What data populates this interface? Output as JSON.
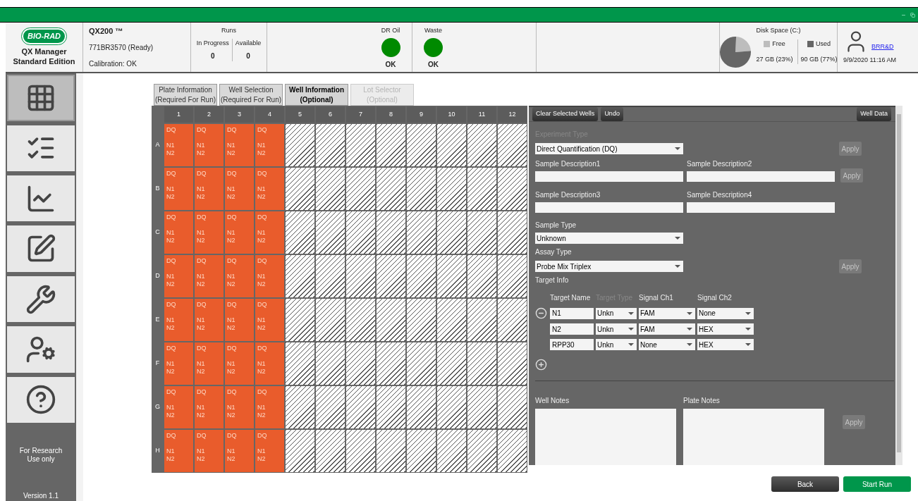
{
  "header": {
    "logo": "BIO-RAD",
    "product": "QX Manager Standard Edition",
    "instrument": {
      "model": "QX200 ™",
      "serial": "771BR3570 (Ready)",
      "calibration": "Calibration: OK"
    },
    "runs": {
      "title": "Runs",
      "columns": [
        {
          "label": "In Progress",
          "value": "0"
        },
        {
          "label": "Available",
          "value": "0"
        }
      ]
    },
    "indicators": [
      {
        "label": "DR Oil",
        "status": "OK",
        "color": "#008a00"
      },
      {
        "label": "Waste",
        "status": "OK",
        "color": "#008a00"
      }
    ],
    "disk": {
      "title": "Disk Space (C:)",
      "chart_data": {
        "type": "pie",
        "categories": [
          "Free",
          "Used"
        ],
        "values": [
          23,
          77
        ]
      },
      "readings": [
        "27 GB (23%)",
        "90 GB (77%)"
      ]
    },
    "user": {
      "name": "BRR&D",
      "datetime": "9/9/2020 11:16 AM"
    }
  },
  "sidebar": {
    "items": [
      {
        "kind": "plate-run",
        "selected": true
      },
      {
        "kind": "checklist",
        "selected": false
      },
      {
        "kind": "chart",
        "selected": false
      },
      {
        "kind": "layout-edit",
        "selected": false
      },
      {
        "kind": "tools",
        "selected": false
      },
      {
        "kind": "users",
        "selected": false
      },
      {
        "kind": "help",
        "selected": false
      }
    ],
    "note": "For Research Use only",
    "version": "Version 1.1"
  },
  "tabs": [
    {
      "title": "Plate Information",
      "subtitle": "(Required For Run)",
      "selected": false,
      "disabled": false
    },
    {
      "title": "Well Selection",
      "subtitle": "(Required For Run)",
      "selected": false,
      "disabled": false
    },
    {
      "title": "Well Information",
      "subtitle": "(Optional)",
      "selected": true,
      "disabled": false
    },
    {
      "title": "Lot Selector",
      "subtitle": "(Optional)",
      "selected": false,
      "disabled": true
    }
  ],
  "plate": {
    "columns": [
      "1",
      "2",
      "3",
      "4",
      "5",
      "6",
      "7",
      "8",
      "9",
      "10",
      "11",
      "12"
    ],
    "rows": [
      {
        "label": "A",
        "wells": [
          {
            "kind": "sample",
            "lines": [
              "DQ",
              "N1",
              "N2"
            ]
          },
          {
            "kind": "sample",
            "lines": [
              "DQ",
              "N1",
              "N2"
            ]
          },
          {
            "kind": "sample",
            "lines": [
              "DQ",
              "N1",
              "N2"
            ]
          },
          {
            "kind": "sample",
            "lines": [
              "DQ",
              "N1",
              "N2"
            ]
          },
          {
            "kind": "empty"
          },
          {
            "kind": "empty"
          },
          {
            "kind": "empty"
          },
          {
            "kind": "empty"
          },
          {
            "kind": "empty"
          },
          {
            "kind": "empty"
          },
          {
            "kind": "empty"
          },
          {
            "kind": "empty"
          }
        ]
      },
      {
        "label": "B",
        "wells": [
          {
            "kind": "sample",
            "lines": [
              "DQ",
              "N1",
              "N2"
            ]
          },
          {
            "kind": "sample",
            "lines": [
              "DQ",
              "N1",
              "N2"
            ]
          },
          {
            "kind": "sample",
            "lines": [
              "DQ",
              "N1",
              "N2"
            ]
          },
          {
            "kind": "sample",
            "lines": [
              "DQ",
              "N1",
              "N2"
            ]
          },
          {
            "kind": "empty"
          },
          {
            "kind": "empty"
          },
          {
            "kind": "empty"
          },
          {
            "kind": "empty"
          },
          {
            "kind": "empty"
          },
          {
            "kind": "empty"
          },
          {
            "kind": "empty"
          },
          {
            "kind": "empty"
          }
        ]
      },
      {
        "label": "C",
        "wells": [
          {
            "kind": "sample",
            "lines": [
              "DQ",
              "N1",
              "N2"
            ]
          },
          {
            "kind": "sample",
            "lines": [
              "DQ",
              "N1",
              "N2"
            ]
          },
          {
            "kind": "sample",
            "lines": [
              "DQ",
              "N1",
              "N2"
            ]
          },
          {
            "kind": "sample",
            "lines": [
              "DQ",
              "N1",
              "N2"
            ]
          },
          {
            "kind": "empty"
          },
          {
            "kind": "empty"
          },
          {
            "kind": "empty"
          },
          {
            "kind": "empty"
          },
          {
            "kind": "empty"
          },
          {
            "kind": "empty"
          },
          {
            "kind": "empty"
          },
          {
            "kind": "empty"
          }
        ]
      },
      {
        "label": "D",
        "wells": [
          {
            "kind": "sample",
            "lines": [
              "DQ",
              "N1",
              "N2"
            ]
          },
          {
            "kind": "sample",
            "lines": [
              "DQ",
              "N1",
              "N2"
            ]
          },
          {
            "kind": "sample",
            "lines": [
              "DQ",
              "N1",
              "N2"
            ]
          },
          {
            "kind": "sample",
            "lines": [
              "DQ",
              "N1",
              "N2"
            ]
          },
          {
            "kind": "empty"
          },
          {
            "kind": "empty"
          },
          {
            "kind": "empty"
          },
          {
            "kind": "empty"
          },
          {
            "kind": "empty"
          },
          {
            "kind": "empty"
          },
          {
            "kind": "empty"
          },
          {
            "kind": "empty"
          }
        ]
      },
      {
        "label": "E",
        "wells": [
          {
            "kind": "sample",
            "lines": [
              "DQ",
              "N1",
              "N2"
            ]
          },
          {
            "kind": "sample",
            "lines": [
              "DQ",
              "N1",
              "N2"
            ]
          },
          {
            "kind": "sample",
            "lines": [
              "DQ",
              "N1",
              "N2"
            ]
          },
          {
            "kind": "sample",
            "lines": [
              "DQ",
              "N1",
              "N2"
            ]
          },
          {
            "kind": "empty"
          },
          {
            "kind": "empty"
          },
          {
            "kind": "empty"
          },
          {
            "kind": "empty"
          },
          {
            "kind": "empty"
          },
          {
            "kind": "empty"
          },
          {
            "kind": "empty"
          },
          {
            "kind": "empty"
          }
        ]
      },
      {
        "label": "F",
        "wells": [
          {
            "kind": "sample",
            "lines": [
              "DQ",
              "N1",
              "N2"
            ]
          },
          {
            "kind": "sample",
            "lines": [
              "DQ",
              "N1",
              "N2"
            ]
          },
          {
            "kind": "sample",
            "lines": [
              "DQ",
              "N1",
              "N2"
            ]
          },
          {
            "kind": "sample",
            "lines": [
              "DQ",
              "N1",
              "N2"
            ]
          },
          {
            "kind": "empty"
          },
          {
            "kind": "empty"
          },
          {
            "kind": "empty"
          },
          {
            "kind": "empty"
          },
          {
            "kind": "empty"
          },
          {
            "kind": "empty"
          },
          {
            "kind": "empty"
          },
          {
            "kind": "empty"
          }
        ]
      },
      {
        "label": "G",
        "wells": [
          {
            "kind": "sample",
            "lines": [
              "DQ",
              "N1",
              "N2"
            ]
          },
          {
            "kind": "sample",
            "lines": [
              "DQ",
              "N1",
              "N2"
            ]
          },
          {
            "kind": "sample",
            "lines": [
              "DQ",
              "N1",
              "N2"
            ]
          },
          {
            "kind": "sample",
            "lines": [
              "DQ",
              "N1",
              "N2"
            ]
          },
          {
            "kind": "empty"
          },
          {
            "kind": "empty"
          },
          {
            "kind": "empty"
          },
          {
            "kind": "empty"
          },
          {
            "kind": "empty"
          },
          {
            "kind": "empty"
          },
          {
            "kind": "empty"
          },
          {
            "kind": "empty"
          }
        ]
      },
      {
        "label": "H",
        "wells": [
          {
            "kind": "sample",
            "lines": [
              "DQ",
              "N1",
              "N2"
            ]
          },
          {
            "kind": "sample",
            "lines": [
              "DQ",
              "N1",
              "N2"
            ]
          },
          {
            "kind": "sample",
            "lines": [
              "DQ",
              "N1",
              "N2"
            ]
          },
          {
            "kind": "sample",
            "lines": [
              "DQ",
              "N1",
              "N2"
            ]
          },
          {
            "kind": "empty"
          },
          {
            "kind": "empty"
          },
          {
            "kind": "empty"
          },
          {
            "kind": "empty"
          },
          {
            "kind": "empty"
          },
          {
            "kind": "empty"
          },
          {
            "kind": "empty"
          },
          {
            "kind": "empty"
          }
        ]
      }
    ]
  },
  "well_panel": {
    "toolbar": [
      "Clear Selected Wells",
      "Undo"
    ],
    "well_data": "Well Data",
    "experiment_type": {
      "label": "Experiment Type",
      "label_dimmed": true,
      "value": "Direct Quantification (DQ)"
    },
    "descriptions": [
      {
        "label": "Sample Description1"
      },
      {
        "label": "Sample Description2"
      },
      {
        "label": "Sample Description3"
      },
      {
        "label": "Sample Description4"
      }
    ],
    "sample_type": {
      "label": "Sample Type",
      "value": "Unknown"
    },
    "assay_type": {
      "label": "Assay Type",
      "value": "Probe Mix Triplex"
    },
    "apply_buttons": [
      {
        "label": "Apply",
        "disabled": true
      },
      {
        "label": "Apply",
        "disabled": true
      },
      {
        "label": "Apply",
        "disabled": true
      },
      {
        "label": "Apply",
        "disabled": true
      }
    ],
    "target_info": {
      "title": "Target Info",
      "columns": [
        {
          "label": "Target Name",
          "dimmed": false
        },
        {
          "label": "Target Type",
          "dimmed": true
        },
        {
          "label": "Signal Ch1",
          "dimmed": false
        },
        {
          "label": "Signal Ch2",
          "dimmed": false
        }
      ],
      "rows": [
        {
          "name": "N1",
          "type": "Unkn",
          "ch1": "FAM",
          "ch2": "None",
          "removable": true
        },
        {
          "name": "N2",
          "type": "Unkn",
          "ch1": "FAM",
          "ch2": "HEX",
          "removable": false
        },
        {
          "name": "RPP30",
          "type": "Unkn",
          "ch1": "None",
          "ch2": "HEX",
          "removable": false
        }
      ]
    },
    "well_notes": "Well Notes",
    "plate_notes": "Plate Notes"
  },
  "footer": {
    "buttons": [
      {
        "label": "Back",
        "kind": "secondary"
      },
      {
        "label": "Start Run",
        "kind": "primary"
      }
    ]
  }
}
